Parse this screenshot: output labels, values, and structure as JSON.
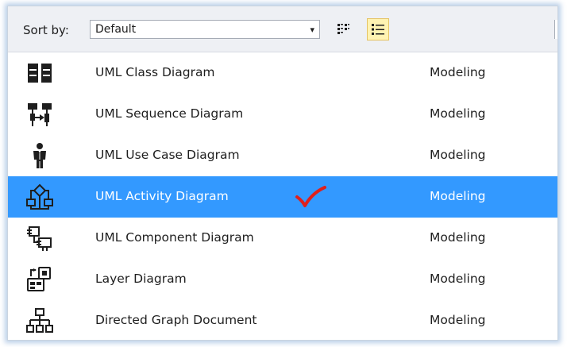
{
  "toolbar": {
    "sort_label": "Sort by:",
    "sort_value": "Default",
    "dropdown_glyph": "▾",
    "view_buttons": [
      {
        "icon": "small-icons-view-icon",
        "selected": false
      },
      {
        "icon": "details-view-icon",
        "selected": true
      }
    ]
  },
  "templates": [
    {
      "name": "UML Class Diagram",
      "category": "Modeling",
      "icon": "uml-class-diagram-icon",
      "selected": false
    },
    {
      "name": "UML Sequence Diagram",
      "category": "Modeling",
      "icon": "uml-sequence-diagram-icon",
      "selected": false
    },
    {
      "name": "UML Use Case Diagram",
      "category": "Modeling",
      "icon": "uml-use-case-diagram-icon",
      "selected": false
    },
    {
      "name": "UML Activity Diagram",
      "category": "Modeling",
      "icon": "uml-activity-diagram-icon",
      "selected": true
    },
    {
      "name": "UML Component Diagram",
      "category": "Modeling",
      "icon": "uml-component-diagram-icon",
      "selected": false
    },
    {
      "name": "Layer Diagram",
      "category": "Modeling",
      "icon": "layer-diagram-icon",
      "selected": false
    },
    {
      "name": "Directed Graph Document",
      "category": "Modeling",
      "icon": "directed-graph-icon",
      "selected": false
    }
  ],
  "colors": {
    "selection": "#3399ff",
    "toolbar_bg": "#eef0f4",
    "checkmark": "#e0201c",
    "active_view_button": "#fff3b2"
  }
}
